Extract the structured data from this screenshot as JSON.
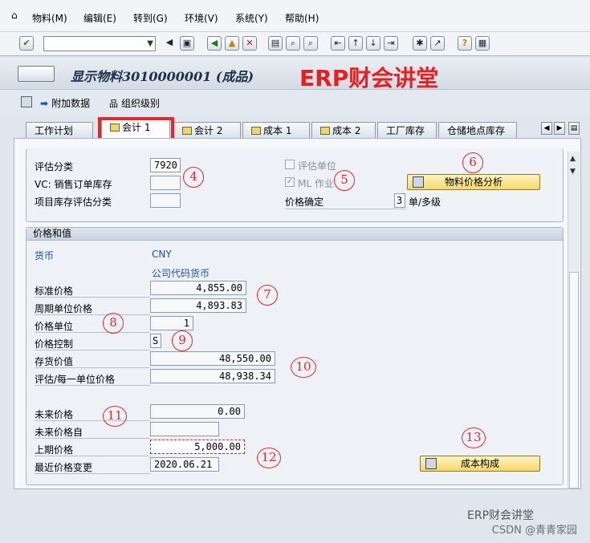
{
  "menu": {
    "items": [
      "物料(M)",
      "编辑(E)",
      "转到(G)",
      "环境(V)",
      "系统(Y)",
      "帮助(H)"
    ]
  },
  "toolbar": {
    "command_value": "",
    "icons": [
      "check-icon",
      "back-icon",
      "save-icon",
      "back-green-icon",
      "exit-icon",
      "cancel-icon",
      "print-icon",
      "find-icon",
      "find-next-icon",
      "first-page-icon",
      "prev-page-icon",
      "next-page-icon",
      "last-page-icon",
      "create-session-icon",
      "shortcut-icon",
      "help-icon",
      "layout-icon"
    ]
  },
  "title": {
    "text": "显示物料3010000001 (成品)",
    "watermark": "ERP财会讲堂"
  },
  "app_toolbar": {
    "additional_data": "附加数据",
    "org_levels": "组织级别"
  },
  "tabs": [
    "工作计划",
    "会计 1",
    "会计 2",
    "成本 1",
    "成本 2",
    "工厂库存",
    "仓储地点库存"
  ],
  "active_tab": "会计 1",
  "valuation": {
    "valuation_class_label": "评估分类",
    "valuation_class_value": "7920",
    "vc_label": "VC: 销售订单库存",
    "vc_value": "",
    "project_stock_label": "项目库存评估分类",
    "project_stock_value": "",
    "valuation_unit_label": "评估单位",
    "ml_label": "ML 作业",
    "ml_checked": true,
    "price_determination_label": "价格确定",
    "price_determination_value": "3",
    "price_determination_text": "单/多级",
    "analysis_button": "物料价格分析"
  },
  "prices": {
    "group_title": "价格和值",
    "currency_label": "货币",
    "currency_value": "CNY",
    "company_currency": "公司代码货币",
    "standard_price_label": "标准价格",
    "standard_price": "4,855.00",
    "periodic_price_label": "周期单位价格",
    "periodic_price": "4,893.83",
    "price_unit_label": "价格单位",
    "price_unit": "1",
    "price_control_label": "价格控制",
    "price_control": "S",
    "inventory_value_label": "存货价值",
    "inventory_value": "48,550.00",
    "valuation_unit_price_label": "评估/每一单位价格",
    "valuation_unit_price": "48,938.34",
    "future_price_label": "未来价格",
    "future_price": "0.00",
    "future_price_from_label": "未来价格自",
    "future_price_from": "",
    "previous_price_label": "上期价格",
    "previous_price": "5,000.00",
    "last_change_label": "最近价格变更",
    "last_change": "2020.06.21",
    "cost_structure_button": "成本构成"
  },
  "annotations": [
    "4",
    "5",
    "6",
    "7",
    "8",
    "9",
    "10",
    "11",
    "12",
    "13"
  ],
  "footer": {
    "wechat": "ERP财会讲堂",
    "csdn": "CSDN @青青家园"
  },
  "colors": {
    "highlight_red": "#e5262b",
    "label_blue": "#1a4fb3",
    "button_yellow": "#f6d868"
  }
}
